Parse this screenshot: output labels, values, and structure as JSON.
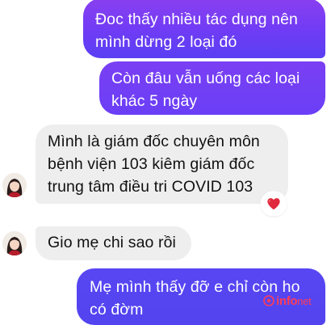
{
  "messages": [
    {
      "direction": "outgoing",
      "text": "Đoc thấy nhiều tác dụng nên\nmình dừng 2 loại đó"
    },
    {
      "direction": "outgoing",
      "text": "Còn đâu vẫn uống các loại\nkhác 5 ngày"
    },
    {
      "direction": "incoming",
      "text": "Mình là giám đốc chuyên môn\nbệnh viện 103 kiêm giám đốc\ntrung tâm điều tri COVID 103",
      "reaction": "heart-icon"
    },
    {
      "direction": "incoming",
      "text": "Gio mẹ chi sao rồi"
    },
    {
      "direction": "outgoing",
      "text": "Mẹ mình thấy đỡ e chỉ còn ho\ncó đờm"
    }
  ],
  "colors": {
    "outgoing_bubble": "#6f3cf5",
    "incoming_bubble": "#eeeeef",
    "reaction_heart": "#e02a3c",
    "watermark": "#ff3d57"
  },
  "watermark": {
    "brand": "info",
    "suffix": "net"
  }
}
